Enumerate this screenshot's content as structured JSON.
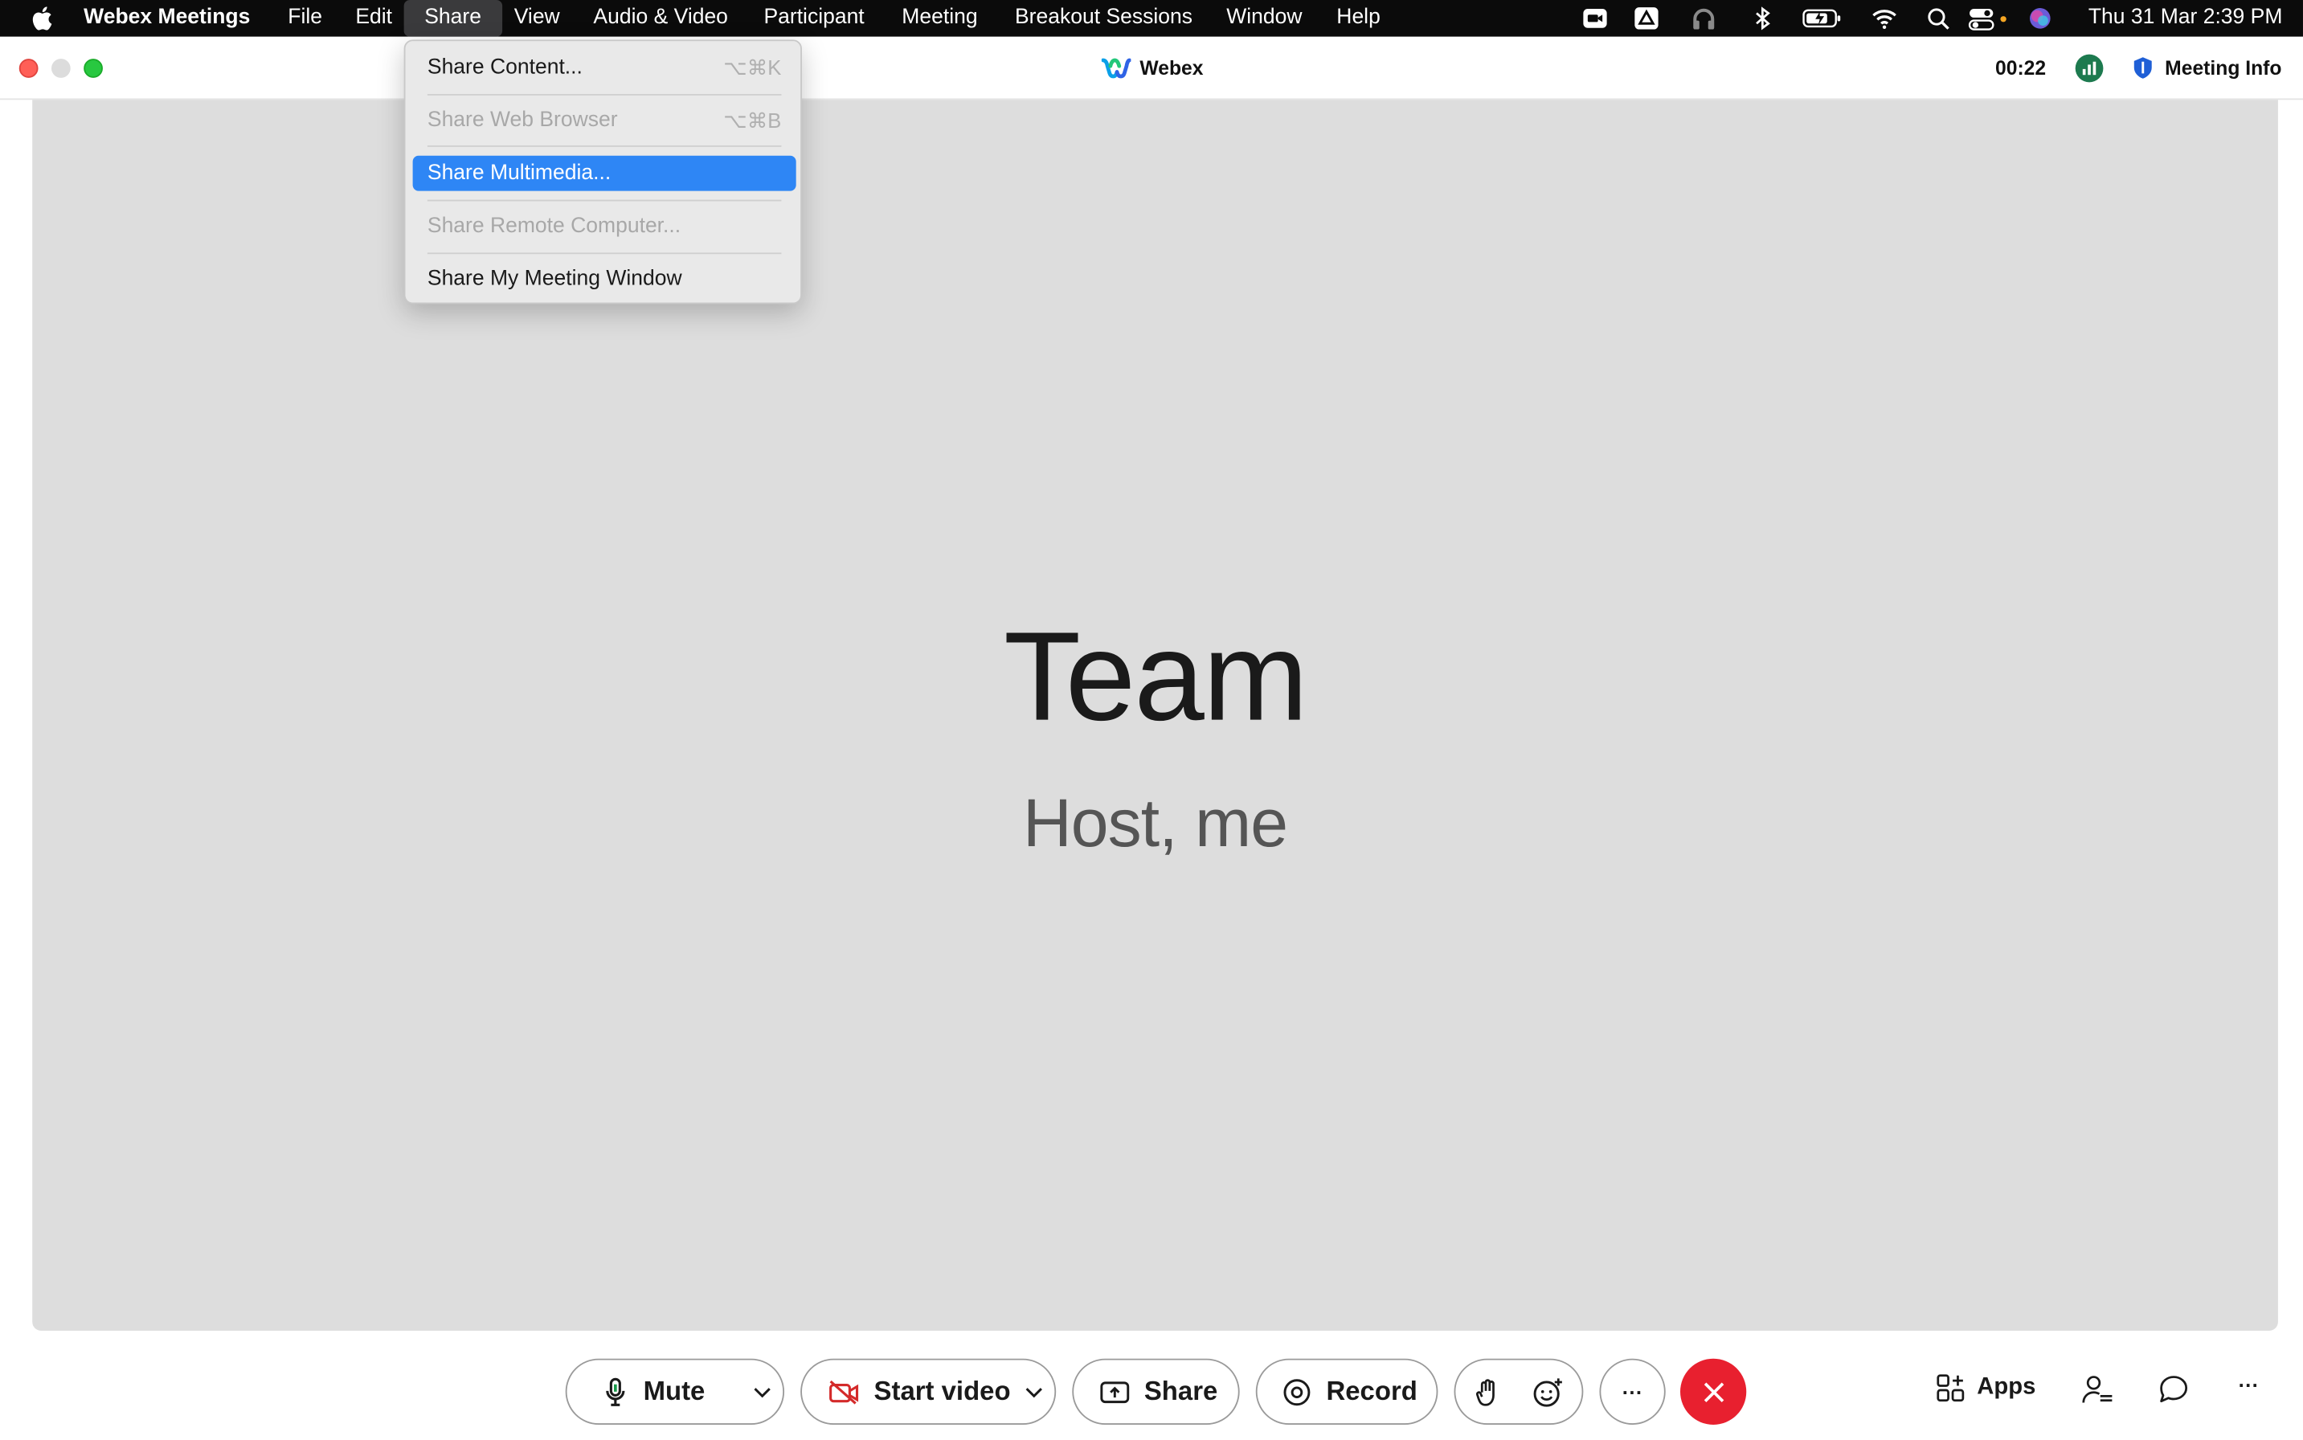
{
  "menubar": {
    "app_name": "Webex Meetings",
    "items": [
      "File",
      "Edit",
      "Share",
      "View",
      "Audio & Video",
      "Participant",
      "Meeting",
      "Breakout Sessions",
      "Window",
      "Help"
    ],
    "active_item": "Share",
    "clock": "Thu 31 Mar  2:39 PM",
    "status_icons": [
      "zoom-icon",
      "drive-icon",
      "headphones-icon",
      "bluetooth-icon",
      "battery-icon",
      "wifi-icon",
      "spotlight-search-icon",
      "control-center-icon",
      "siri-icon"
    ]
  },
  "window": {
    "title": "Webex",
    "timer": "00:22",
    "meeting_info_label": "Meeting Info"
  },
  "share_menu": {
    "items": [
      {
        "label": "Share Content...",
        "shortcut": "⌥⌘K",
        "state": "enabled"
      },
      {
        "label": "Share Web Browser",
        "shortcut": "⌥⌘B",
        "state": "disabled"
      },
      {
        "label": "Share Multimedia...",
        "shortcut": "",
        "state": "highlighted"
      },
      {
        "label": "Share Remote Computer...",
        "shortcut": "",
        "state": "disabled"
      },
      {
        "label": "Share My Meeting Window",
        "shortcut": "",
        "state": "enabled"
      }
    ]
  },
  "stage": {
    "title": "Team",
    "subtitle": "Host, me"
  },
  "toolbar": {
    "mute_label": "Mute",
    "start_video_label": "Start video",
    "share_label": "Share",
    "record_label": "Record",
    "more_label": "···",
    "apps_label": "Apps",
    "more_right_label": "···",
    "colors": {
      "end_call": "#e8202f",
      "video_off": "#d42a2a",
      "highlight": "#2e86f5"
    }
  }
}
